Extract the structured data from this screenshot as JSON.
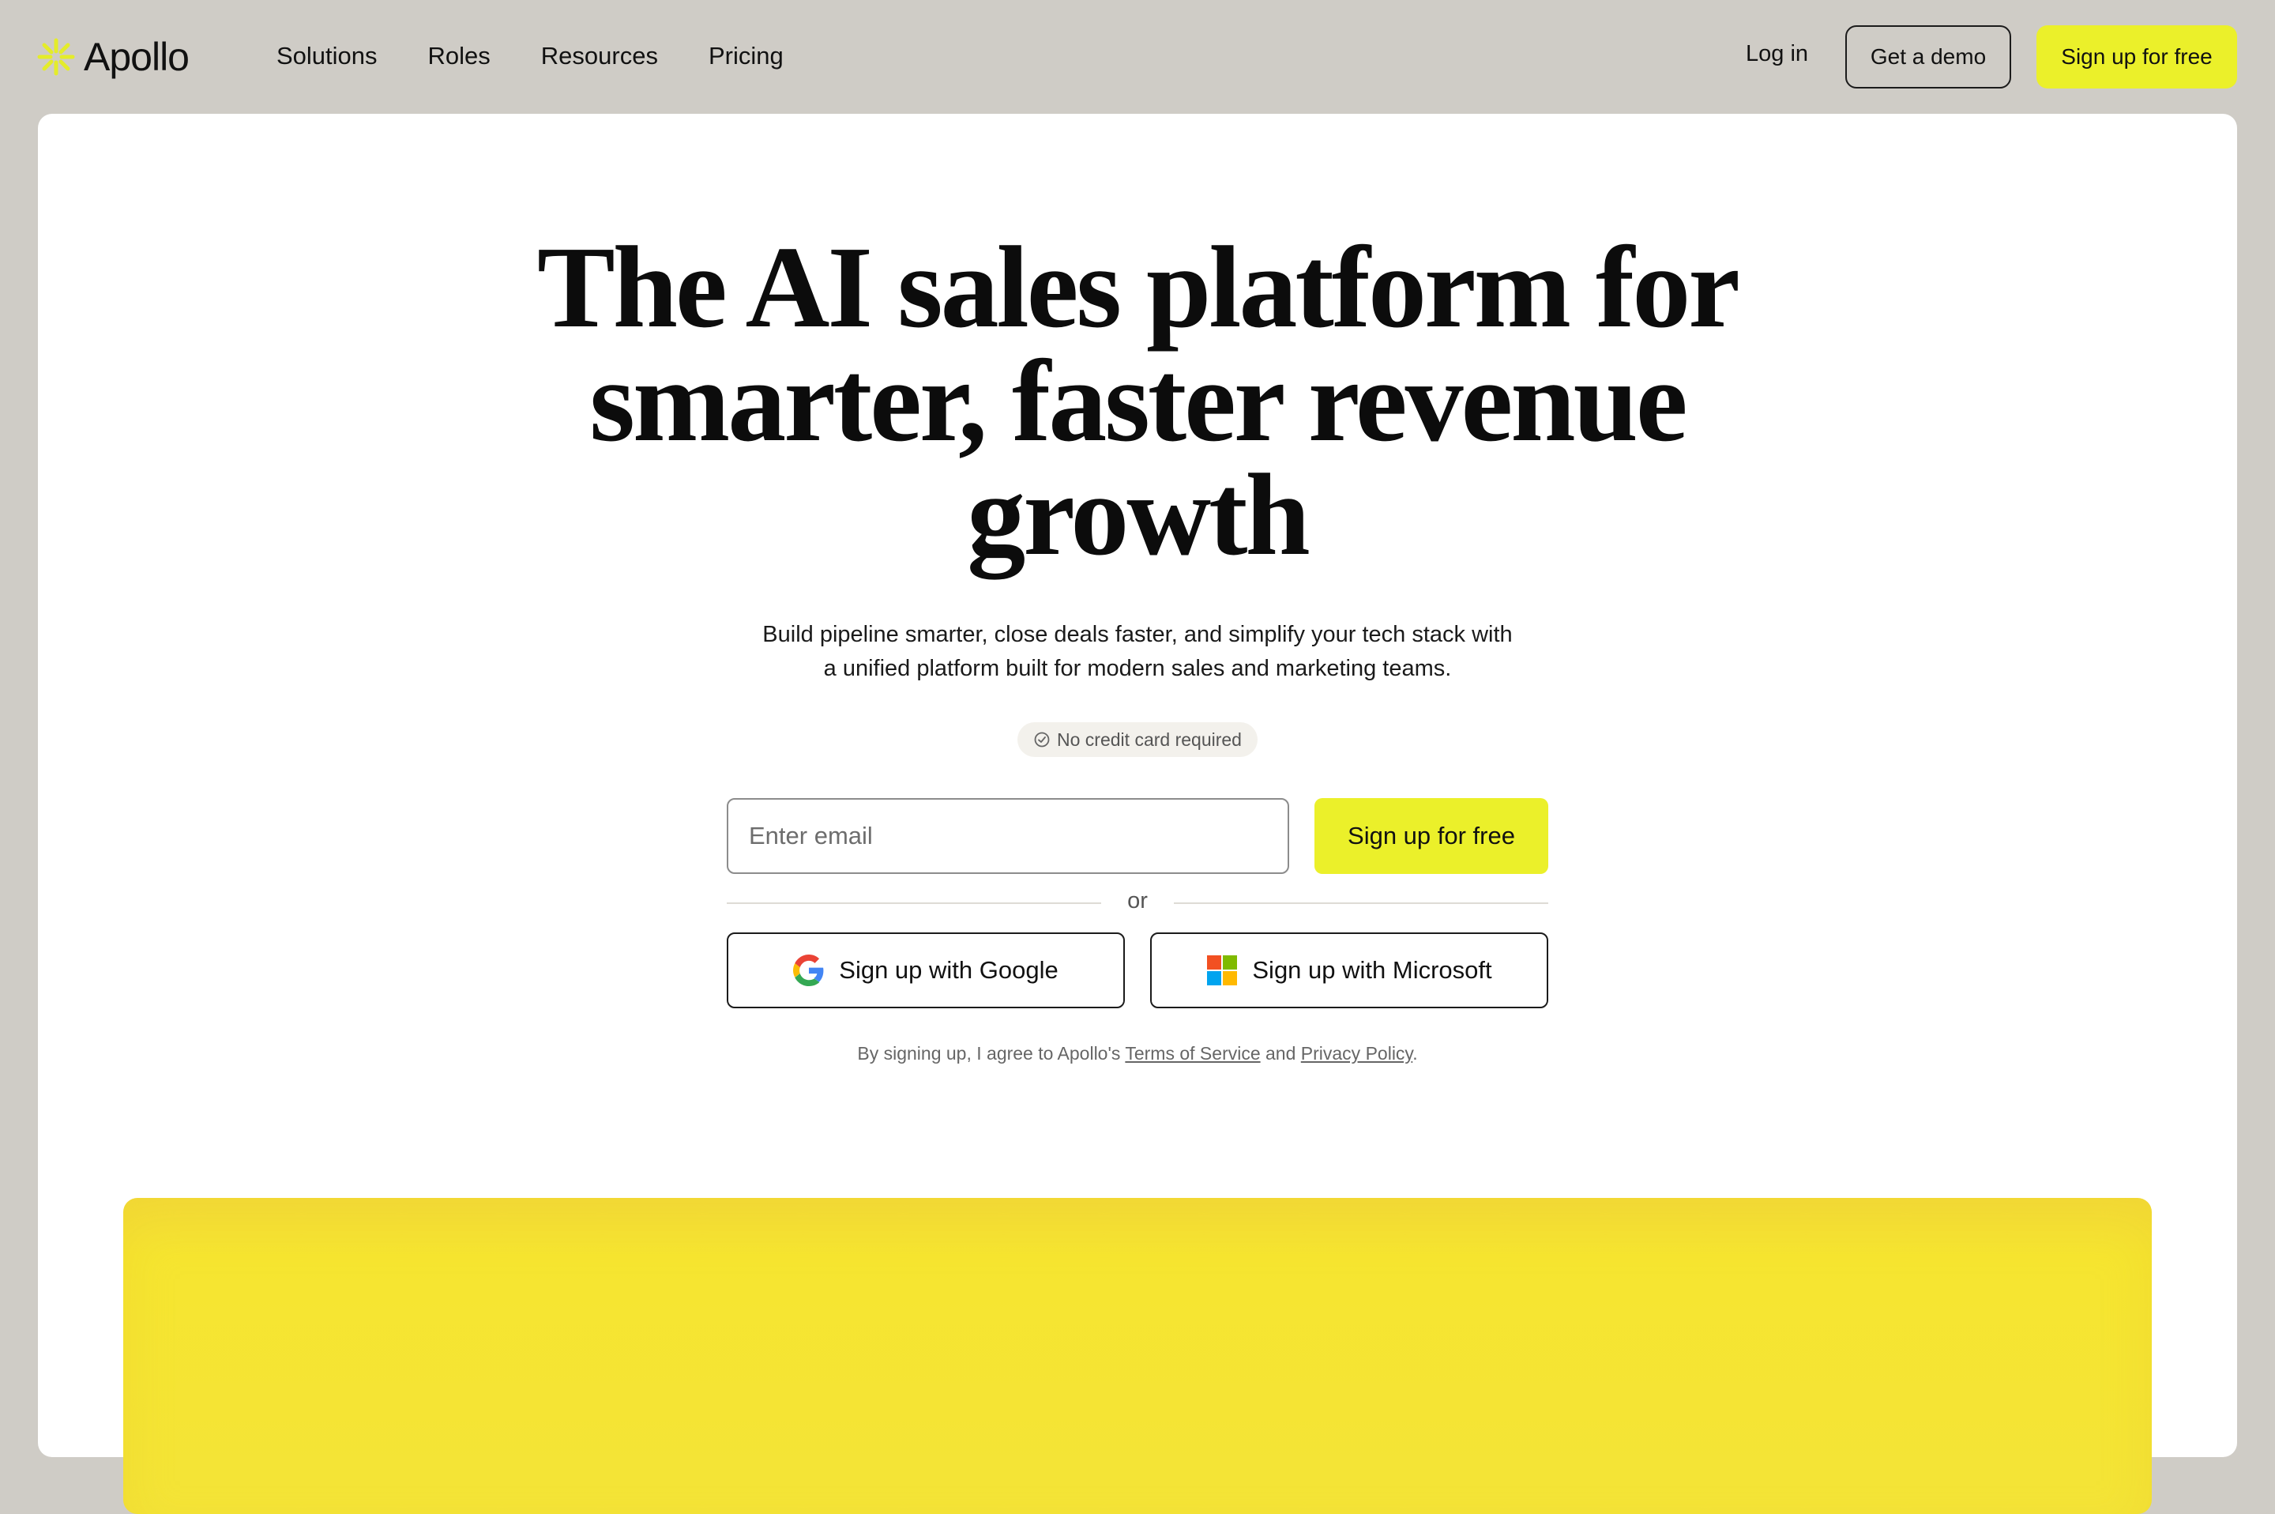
{
  "brand": {
    "name": "Apollo",
    "accent_color": "#ebf02a",
    "logo_icon": "asterisk-burst-icon"
  },
  "nav": {
    "items": [
      {
        "label": "Solutions"
      },
      {
        "label": "Roles"
      },
      {
        "label": "Resources"
      },
      {
        "label": "Pricing"
      }
    ],
    "login_label": "Log in",
    "demo_label": "Get a demo",
    "signup_label": "Sign up for free"
  },
  "hero": {
    "title_lines": [
      "The AI sales platform for",
      "smarter, faster revenue",
      "growth"
    ],
    "subtitle_line1": "Build pipeline smarter, close deals faster, and simplify your tech stack with",
    "subtitle_line2": "a unified platform built for modern sales and marketing teams.",
    "badge": "No credit card required",
    "email_placeholder": "Enter email",
    "signup_label": "Sign up for free",
    "divider": "or",
    "google_label": "Sign up with Google",
    "microsoft_label": "Sign up with Microsoft",
    "legal": {
      "prefix": "By signing up, I agree to Apollo's",
      "terms": "Terms of Service",
      "and": "and",
      "privacy": "Privacy Policy",
      "suffix": "."
    }
  },
  "panel": {
    "color": "#f4e437"
  }
}
